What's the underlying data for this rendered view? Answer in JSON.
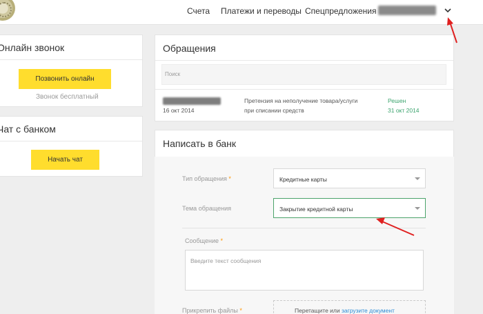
{
  "header": {
    "nav": [
      "Счета",
      "Платежи и переводы",
      "Спецпредложения"
    ]
  },
  "left": {
    "online_call": {
      "title": "Онлайн звонок",
      "button": "Позвонить онлайн",
      "note": "Звонок бесплатный"
    },
    "chat": {
      "title": "Чат с банком",
      "button": "Начать чат"
    }
  },
  "requests": {
    "title": "Обращения",
    "search_placeholder": "Поиск",
    "items": [
      {
        "date": "16 окт 2014",
        "subject_line1": "Претензия на неполучение товара/услуги",
        "subject_line2": "при списании средств",
        "status": "Решен",
        "status_date": "31 окт 2014"
      }
    ]
  },
  "write": {
    "title": "Написать в банк",
    "type_label": "Тип обращения",
    "type_value": "Кредитные карты",
    "topic_label": "Тема обращения",
    "topic_value": "Закрытие кредитной карты",
    "message_label": "Сообщение",
    "message_placeholder": "Введите текст сообщения",
    "attach_label": "Прикрепить файлы",
    "drop_text": "Перетащите или",
    "upload_link": "загрузите документ",
    "required_mark": "*"
  },
  "colors": {
    "accent_yellow": "#ffdd2d",
    "status_green": "#3aa36d",
    "annotation_red": "#e02020"
  }
}
